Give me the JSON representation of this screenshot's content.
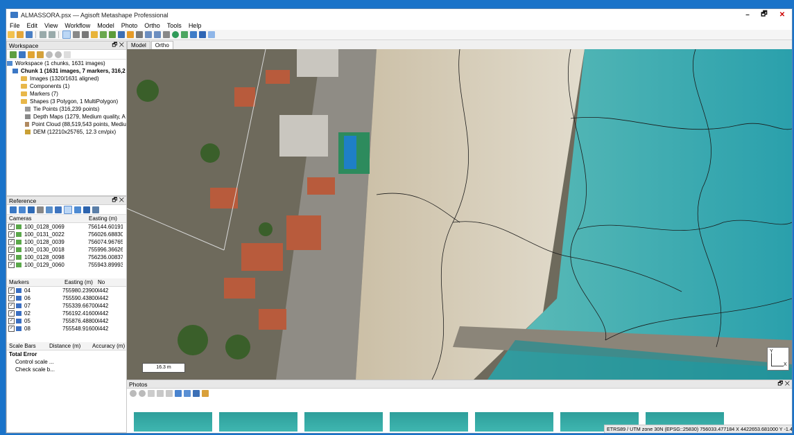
{
  "window": {
    "title": "ALMASSORA.psx — Agisoft Metashape Professional",
    "controls": [
      "–",
      "🗗",
      "✕"
    ]
  },
  "menu": [
    "File",
    "Edit",
    "View",
    "Workflow",
    "Model",
    "Photo",
    "Ortho",
    "Tools",
    "Help"
  ],
  "workspace": {
    "title": "Workspace",
    "root": "Workspace (1 chunks, 1631 images)",
    "chunk": "Chunk 1 (1631 images, 7 markers, 316,2",
    "items": [
      "Images (1320/1631 aligned)",
      "Components (1)",
      "Markers (7)",
      "Shapes (3 Polygon, 1 MultiPolygon)",
      "Tie Points (316,239 points)",
      "Depth Maps (1279, Medium quality, A",
      "Point Cloud (88,519,543 points, Mediu",
      "DEM (12210x25765, 12.3 cm/pix)"
    ]
  },
  "reference": {
    "title": "Reference",
    "cameras_header": [
      "Cameras",
      "Easting (m)"
    ],
    "cameras": [
      [
        "100_0128_0069",
        "756144.60191"
      ],
      [
        "100_0131_0022",
        "756026.68830"
      ],
      [
        "100_0128_0039",
        "756074.96765"
      ],
      [
        "100_0130_0018",
        "755996.36626"
      ],
      [
        "100_0128_0098",
        "756236.00837"
      ],
      [
        "100_0129_0060",
        "755943.89993"
      ]
    ],
    "markers_header": [
      "Markers",
      "Easting (m)",
      "No"
    ],
    "markers": [
      [
        "04",
        "755980.239000",
        "442"
      ],
      [
        "06",
        "755590.438000",
        "442"
      ],
      [
        "07",
        "755339.667000",
        "442"
      ],
      [
        "02",
        "756192.416000",
        "442"
      ],
      [
        "05",
        "755876.488000",
        "442"
      ],
      [
        "08",
        "755548.916000",
        "442"
      ]
    ],
    "scalebars_header": [
      "Scale Bars",
      "Distance (m)",
      "Accuracy (m)"
    ],
    "total_error": "Total Error",
    "control_scale": "Control scale ...",
    "check_scale": "Check scale b..."
  },
  "view": {
    "tabs": [
      "Model",
      "Ortho"
    ],
    "scale_label": "16.3 m",
    "axis_y": "Y",
    "axis_x": "X"
  },
  "photos": {
    "title": "Photos"
  },
  "status": "ETRS89 / UTM zone 30N (EPSG::25830)  756033.477184 X  4422653.681000 Y  -1.473 m"
}
